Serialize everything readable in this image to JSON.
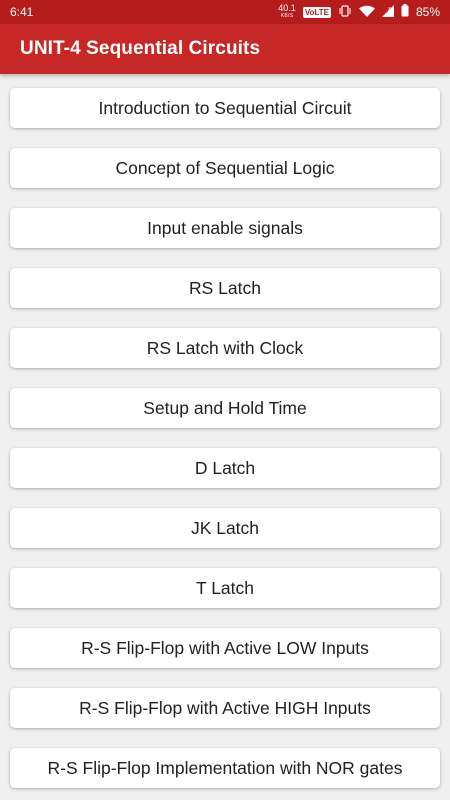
{
  "status_bar": {
    "time": "6:41",
    "net_speed_value": "40.1",
    "net_speed_unit": "KB/S",
    "volte": "VoLTE",
    "battery": "85%"
  },
  "app_bar": {
    "title": "UNIT-4 Sequential Circuits"
  },
  "topics": [
    "Introduction to Sequential Circuit",
    "Concept of Sequential Logic",
    "Input enable signals",
    "RS Latch",
    "RS Latch with Clock",
    "Setup and Hold Time",
    "D Latch",
    "JK Latch",
    "T Latch",
    "R-S Flip-Flop with Active LOW Inputs",
    "R-S Flip-Flop with Active HIGH Inputs",
    "R-S Flip-Flop Implementation with NOR gates"
  ],
  "colors": {
    "appbar": "#c62828",
    "statusbar": "#b71c1c",
    "background": "#efefef"
  }
}
